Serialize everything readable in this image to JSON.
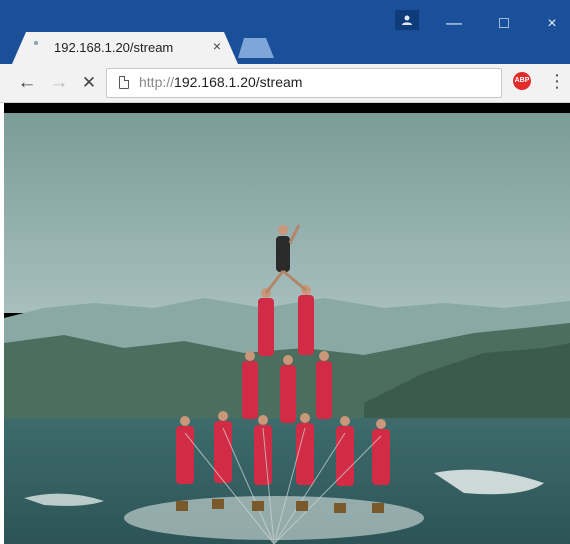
{
  "browser": {
    "tab": {
      "title": "192.168.1.20/stream",
      "close_glyph": "×"
    },
    "url": {
      "scheme": "http://",
      "host_path": "192.168.1.20/stream"
    },
    "window_controls": {
      "minimize": "—",
      "maximize": "□",
      "close": "×"
    },
    "nav": {
      "back": "←",
      "forward": "→",
      "stop": "✕"
    },
    "extension": {
      "label": "ABP",
      "color": "#e22b2b"
    },
    "menu_glyph": "⋮"
  },
  "colors": {
    "titlebar": "#1a4f9a",
    "toolbar": "#f2f2f2"
  },
  "content": {
    "type": "video-stream",
    "description_icon": "video-frame"
  }
}
